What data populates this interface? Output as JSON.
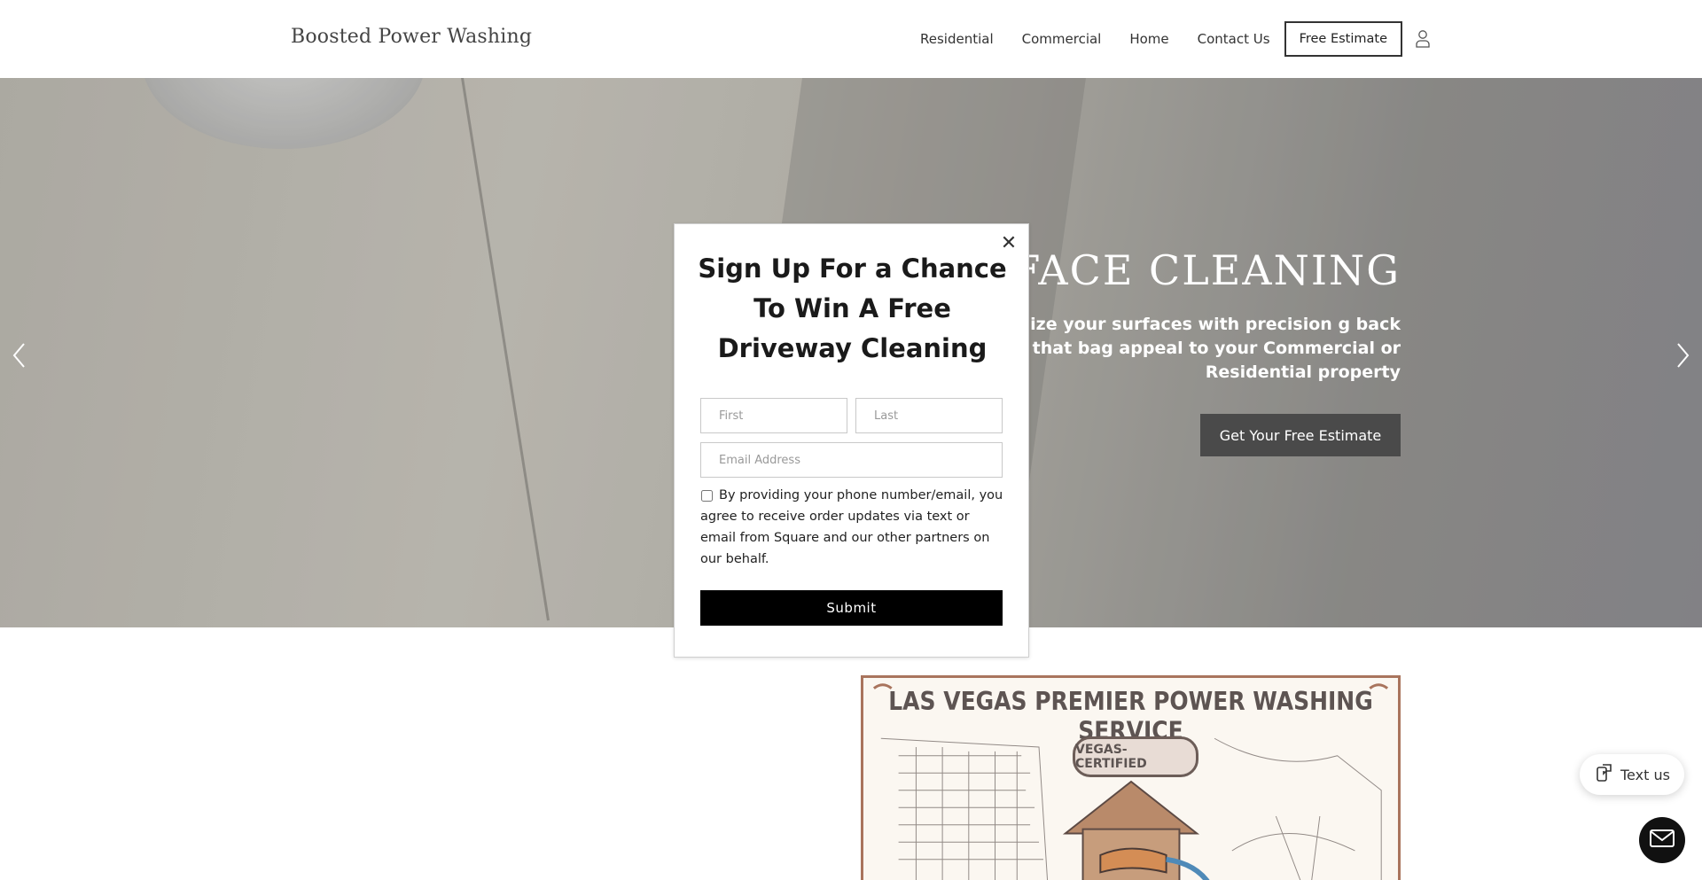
{
  "header": {
    "brand": "Boosted Power Washing",
    "nav": [
      {
        "label": "Residential"
      },
      {
        "label": "Commercial"
      },
      {
        "label": "Home"
      },
      {
        "label": "Contact Us"
      }
    ],
    "cta_label": "Free Estimate",
    "account_icon": "user-icon"
  },
  "hero": {
    "heading": "SURFACE CLEANING",
    "subtext": "Revitalize your surfaces with precision g back that bag appeal to your Commercial or Residential property",
    "cta_label": "Get Your Free Estimate",
    "prev_icon": "chevron-left-icon",
    "next_icon": "chevron-right-icon"
  },
  "poster": {
    "title": "LAS VEGAS PREMIER POWER WASHING SERVICE",
    "badge": "VEGAS-CERTIFIED"
  },
  "widgets": {
    "textus_label": "Text us",
    "textus_icon": "chat-phone-icon",
    "mail_icon": "mail-icon"
  },
  "modal": {
    "title": "Sign Up For a Chance To Win A Free Driveway Cleaning",
    "first_placeholder": "First",
    "last_placeholder": "Last",
    "email_placeholder": "Email Address",
    "consent": "By providing your phone number/email, you agree to receive order updates via text or email from Square and our other partners on our behalf.",
    "consent_checked": false,
    "submit_label": "Submit",
    "close_icon": "close-icon"
  },
  "colors": {
    "cta_bg": "#4a4a4a",
    "submit_bg": "#000000",
    "poster_frame": "#a9745d"
  }
}
